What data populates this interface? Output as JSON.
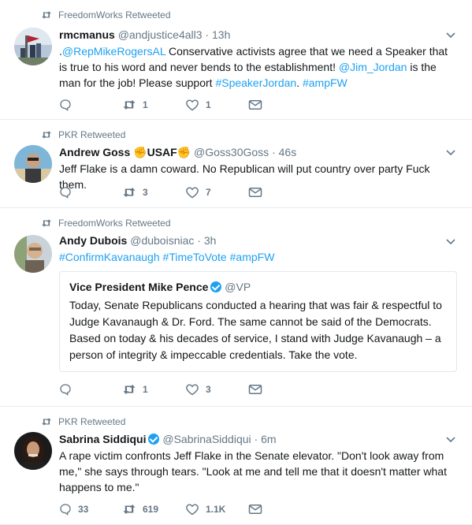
{
  "colors": {
    "link": "#1da1f2",
    "muted": "#657786",
    "verified": "#1da1f2",
    "divider": "#e6ecf0"
  },
  "tweets": [
    {
      "retweeted_by": "FreedomWorks Retweeted",
      "name": "rmcmanus",
      "handle": "@andjustice4all3",
      "time": "13h",
      "text_parts": [
        {
          "t": ".",
          "link": false
        },
        {
          "t": "@RepMikeRogersAL",
          "link": true
        },
        {
          "t": " Conservative activists agree that we need a Speaker that is true to his word and never bends to the establishment! ",
          "link": false
        },
        {
          "t": "@Jim_Jordan",
          "link": true
        },
        {
          "t": " is the man for the job! Please support ",
          "link": false
        },
        {
          "t": "#SpeakerJordan",
          "link": true
        },
        {
          "t": ". ",
          "link": false
        },
        {
          "t": "#ampFW",
          "link": true
        }
      ],
      "retweets": "1",
      "likes": "1",
      "replies": ""
    },
    {
      "retweeted_by": "PKR Retweeted",
      "name": "Andrew Goss",
      "name_suffix": "USAF",
      "handle": "@Goss30Goss",
      "time": "46s",
      "text": "Jeff Flake is a damn coward. No Republican will put country over party Fuck them.",
      "retweets": "3",
      "likes": "7",
      "replies": ""
    },
    {
      "retweeted_by": "FreedomWorks Retweeted",
      "name": "Andy Dubois",
      "handle": "@duboisniac",
      "time": "3h",
      "text_parts": [
        {
          "t": "#ConfirmKavanaugh",
          "link": true
        },
        {
          "t": " ",
          "link": false
        },
        {
          "t": "#TimeToVote",
          "link": true
        },
        {
          "t": " ",
          "link": false
        },
        {
          "t": "#ampFW",
          "link": true
        }
      ],
      "quote": {
        "name": "Vice President Mike Pence",
        "handle": "@VP",
        "text": "Today, Senate Republicans conducted a hearing that was fair & respectful to Judge Kavanaugh & Dr. Ford. The same cannot be said of the Democrats. Based on today & his decades of service, I stand with Judge Kavanaugh – a person of integrity & impeccable credentials. Take the vote."
      },
      "retweets": "1",
      "likes": "3",
      "replies": ""
    },
    {
      "retweeted_by": "PKR Retweeted",
      "name": "Sabrina Siddiqui",
      "handle": "@SabrinaSiddiqui",
      "time": "6m",
      "text": "A rape victim confronts Jeff Flake in the Senate elevator. \"Don't look away from me,\" she says through tears. \"Look at me and tell me that it doesn't matter what happens to me.\"",
      "replies": "33",
      "retweets": "619",
      "likes": "1.1K"
    }
  ],
  "sep": "·"
}
